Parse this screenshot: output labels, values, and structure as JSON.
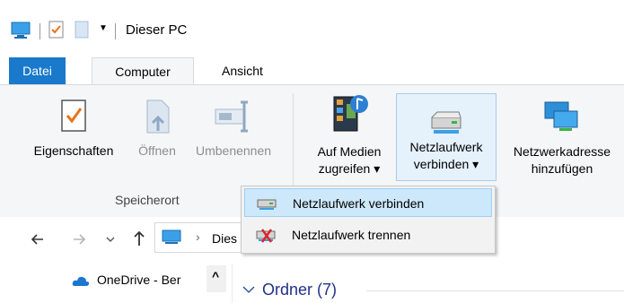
{
  "titlebar": {
    "title": "Dieser PC",
    "qat_dropdown_glyph": "▼"
  },
  "tabs": {
    "file": "Datei",
    "computer": "Computer",
    "view": "Ansicht"
  },
  "ribbon": {
    "properties": "Eigenschaften",
    "open": "Öffnen",
    "rename": "Umbenennen",
    "access_media_line1": "Auf Medien",
    "access_media_line2": "zugreifen",
    "map_drive_line1": "Netzlaufwerk",
    "map_drive_line2": "verbinden",
    "add_network_location_line1": "Netzwerkadresse",
    "add_network_location_line2": "hinzufügen",
    "group_location": "Speicherort",
    "split_glyph": "▾"
  },
  "dropdown": {
    "connect": "Netzlaufwerk verbinden",
    "disconnect": "Netzlaufwerk trennen"
  },
  "addressbar": {
    "path_partial": "Dies",
    "separator": "›"
  },
  "navpane": {
    "onedrive": "OneDrive - Ber",
    "scroll_up": "^"
  },
  "content": {
    "folders_header": "Ordner (7)",
    "collapse_glyph": "∨"
  }
}
